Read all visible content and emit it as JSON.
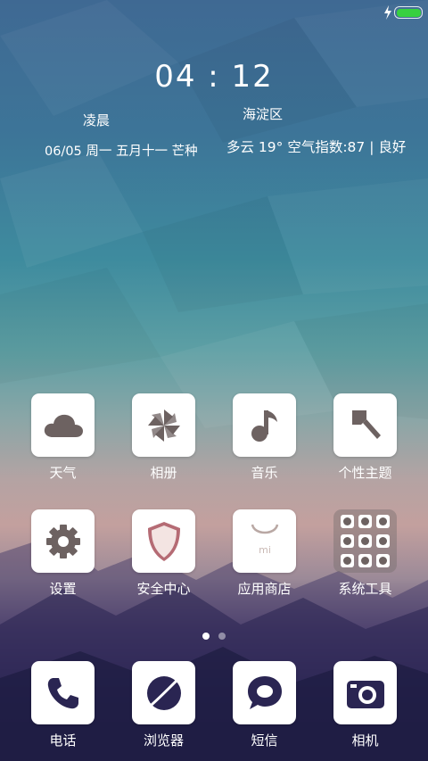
{
  "status_bar": {
    "charge_icon": "lightning-icon",
    "battery_icon": "battery-icon",
    "battery_level": 1.0,
    "battery_color": "#37d13f"
  },
  "lockwidget": {
    "time": "04 : 12",
    "period": "凌晨",
    "date": "06/05 周一 五月十一 芒种",
    "district": "海淀区",
    "weather": "多云 19°  空气指数:87 | 良好"
  },
  "apps": {
    "weather": {
      "label": "天气",
      "icon": "cloud-icon"
    },
    "gallery": {
      "label": "相册",
      "icon": "pinwheel-icon"
    },
    "music": {
      "label": "音乐",
      "icon": "music-note-icon"
    },
    "themes": {
      "label": "个性主题",
      "icon": "paintbrush-icon"
    },
    "settings": {
      "label": "设置",
      "icon": "gear-icon"
    },
    "security": {
      "label": "安全中心",
      "icon": "shield-icon"
    },
    "appstore": {
      "label": "应用商店",
      "icon": "shopping-bag-icon",
      "badge": "mi"
    },
    "tools": {
      "label": "系统工具",
      "icon": "folder-icon"
    }
  },
  "dock": {
    "phone": {
      "label": "电话",
      "icon": "phone-icon"
    },
    "browser": {
      "label": "浏览器",
      "icon": "globe-icon"
    },
    "messages": {
      "label": "短信",
      "icon": "chat-bubble-icon"
    },
    "camera": {
      "label": "相机",
      "icon": "camera-icon"
    }
  },
  "pager": {
    "pages": 2,
    "current": 1
  },
  "colors": {
    "icon_fg": "#6d6261",
    "tile_bg": "#ffffff",
    "dock_icon_fg": "#2a2552"
  }
}
